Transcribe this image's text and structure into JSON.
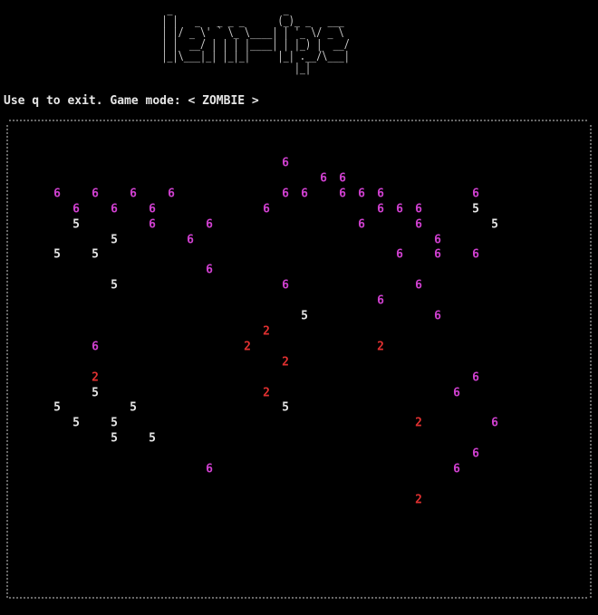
{
  "banner_lines": [
    "    _                    _",
    "   | |   _   _ _ _      (_)_ _   ___",
    "   | |/ _ \\' ` \\_ \\____| | '_ \\/ _ \\",
    "   | |  __/ | | | |____| | |_) |  __/",
    "   |_|\\___|_| |_|_|     |_| .__/\\___|",
    "                           |_|"
  ],
  "status_text": "Use q to exit. Game mode: < ZOMBIE >",
  "game_mode": "ZOMBIE",
  "colors": {
    "background": "#000000",
    "6": "#d040d0",
    "5": "#e6e6e6",
    "2": "#e03030",
    "border": "#cfcfcf"
  },
  "cells": [
    {
      "v": "6",
      "col": 15,
      "row": 1
    },
    {
      "v": "6",
      "col": 17,
      "row": 2
    },
    {
      "v": "6",
      "col": 18,
      "row": 2
    },
    {
      "v": "6",
      "col": 3,
      "row": 3
    },
    {
      "v": "6",
      "col": 5,
      "row": 3
    },
    {
      "v": "6",
      "col": 7,
      "row": 3
    },
    {
      "v": "6",
      "col": 9,
      "row": 3
    },
    {
      "v": "6",
      "col": 15,
      "row": 3
    },
    {
      "v": "6",
      "col": 16,
      "row": 3
    },
    {
      "v": "6",
      "col": 18,
      "row": 3
    },
    {
      "v": "6",
      "col": 19,
      "row": 3
    },
    {
      "v": "6",
      "col": 20,
      "row": 3
    },
    {
      "v": "6",
      "col": 25,
      "row": 3
    },
    {
      "v": "6",
      "col": 4,
      "row": 4
    },
    {
      "v": "6",
      "col": 6,
      "row": 4
    },
    {
      "v": "6",
      "col": 8,
      "row": 4
    },
    {
      "v": "6",
      "col": 14,
      "row": 4
    },
    {
      "v": "6",
      "col": 20,
      "row": 4
    },
    {
      "v": "6",
      "col": 21,
      "row": 4
    },
    {
      "v": "6",
      "col": 22,
      "row": 4
    },
    {
      "v": "5",
      "col": 25,
      "row": 4
    },
    {
      "v": "5",
      "col": 4,
      "row": 5
    },
    {
      "v": "6",
      "col": 8,
      "row": 5
    },
    {
      "v": "6",
      "col": 11,
      "row": 5
    },
    {
      "v": "6",
      "col": 19,
      "row": 5
    },
    {
      "v": "6",
      "col": 22,
      "row": 5
    },
    {
      "v": "5",
      "col": 26,
      "row": 5
    },
    {
      "v": "5",
      "col": 6,
      "row": 6
    },
    {
      "v": "6",
      "col": 10,
      "row": 6
    },
    {
      "v": "6",
      "col": 23,
      "row": 6
    },
    {
      "v": "5",
      "col": 3,
      "row": 7
    },
    {
      "v": "5",
      "col": 5,
      "row": 7
    },
    {
      "v": "6",
      "col": 21,
      "row": 7
    },
    {
      "v": "6",
      "col": 23,
      "row": 7
    },
    {
      "v": "6",
      "col": 25,
      "row": 7
    },
    {
      "v": "6",
      "col": 11,
      "row": 8
    },
    {
      "v": "5",
      "col": 6,
      "row": 9
    },
    {
      "v": "6",
      "col": 15,
      "row": 9
    },
    {
      "v": "6",
      "col": 22,
      "row": 9
    },
    {
      "v": "6",
      "col": 20,
      "row": 10
    },
    {
      "v": "5",
      "col": 16,
      "row": 11
    },
    {
      "v": "6",
      "col": 23,
      "row": 11
    },
    {
      "v": "2",
      "col": 14,
      "row": 12
    },
    {
      "v": "6",
      "col": 5,
      "row": 13
    },
    {
      "v": "2",
      "col": 13,
      "row": 13
    },
    {
      "v": "2",
      "col": 20,
      "row": 13
    },
    {
      "v": "2",
      "col": 15,
      "row": 14
    },
    {
      "v": "2",
      "col": 5,
      "row": 15
    },
    {
      "v": "6",
      "col": 25,
      "row": 15
    },
    {
      "v": "5",
      "col": 5,
      "row": 16
    },
    {
      "v": "2",
      "col": 14,
      "row": 16
    },
    {
      "v": "6",
      "col": 24,
      "row": 16
    },
    {
      "v": "5",
      "col": 3,
      "row": 17
    },
    {
      "v": "5",
      "col": 7,
      "row": 17
    },
    {
      "v": "5",
      "col": 15,
      "row": 17
    },
    {
      "v": "5",
      "col": 4,
      "row": 18
    },
    {
      "v": "5",
      "col": 6,
      "row": 18
    },
    {
      "v": "2",
      "col": 22,
      "row": 18
    },
    {
      "v": "6",
      "col": 26,
      "row": 18
    },
    {
      "v": "5",
      "col": 6,
      "row": 19
    },
    {
      "v": "5",
      "col": 8,
      "row": 19
    },
    {
      "v": "6",
      "col": 25,
      "row": 20
    },
    {
      "v": "6",
      "col": 11,
      "row": 21
    },
    {
      "v": "6",
      "col": 24,
      "row": 21
    },
    {
      "v": "2",
      "col": 22,
      "row": 23
    }
  ]
}
